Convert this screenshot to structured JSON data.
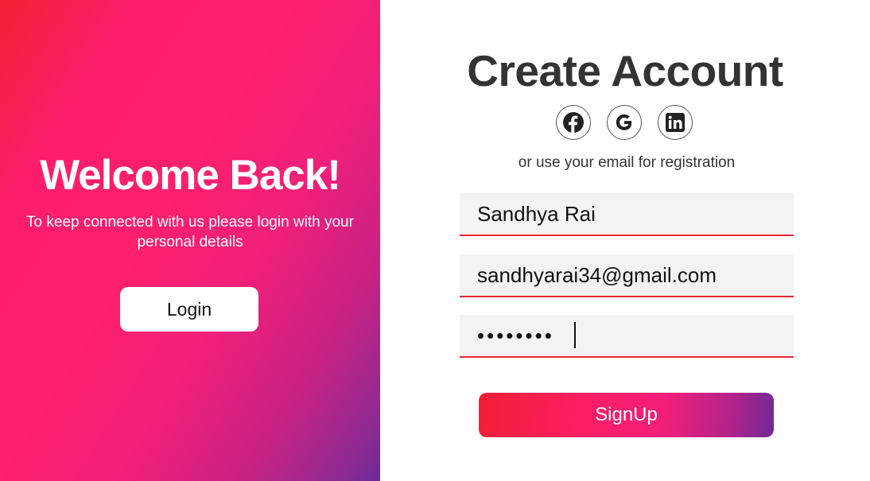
{
  "welcome": {
    "title": "Welcome Back!",
    "text": "To keep connected with us please login with your personal details",
    "login_label": "Login"
  },
  "signup": {
    "title": "Create Account",
    "social": [
      {
        "icon": "facebook-icon"
      },
      {
        "icon": "google-icon"
      },
      {
        "icon": "linkedin-icon"
      }
    ],
    "note": "or use your email for registration",
    "fields": {
      "name": "Sandhya Rai",
      "email": "sandhyarai34@gmail.com",
      "password": "••••••••"
    },
    "submit_label": "SignUp"
  },
  "colors": {
    "gradient_start": "#f22232",
    "gradient_mid": "#ff1f6c",
    "gradient_end": "#6b2a97",
    "field_underline": "#e52a3a",
    "field_background": "#f3f3f3",
    "title_text": "#333333"
  }
}
